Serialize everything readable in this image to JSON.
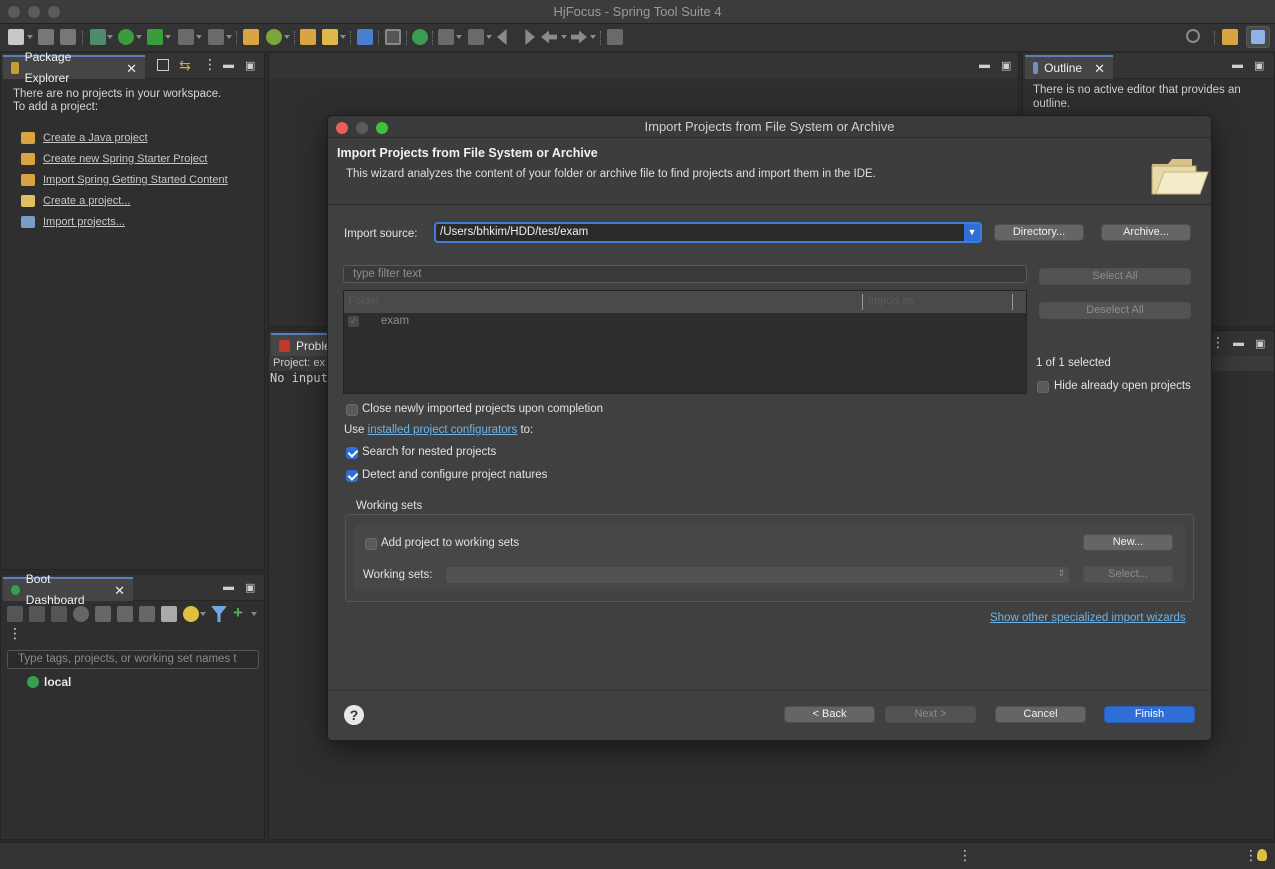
{
  "window": {
    "title": "HjFocus - Spring Tool Suite 4"
  },
  "package_explorer": {
    "tab_label": "Package Explorer",
    "empty_line1": "There are no projects in your workspace.",
    "empty_line2": "To add a project:",
    "links": [
      {
        "label": "Create a Java project",
        "icon": "java-project-icon"
      },
      {
        "label": "Create new Spring Starter Project",
        "icon": "spring-starter-icon"
      },
      {
        "label": "Import Spring Getting Started Content",
        "icon": "spring-guide-icon"
      },
      {
        "label": "Create a project...",
        "icon": "new-project-icon"
      },
      {
        "label": "Import projects...",
        "icon": "import-icon"
      }
    ]
  },
  "outline": {
    "tab_label": "Outline",
    "message": "There is no active editor that provides an outline."
  },
  "problems": {
    "tab_label": "Proble",
    "project_line": "Project: ex",
    "console_text": "No input"
  },
  "boot_dashboard": {
    "tab_label": "Boot Dashboard",
    "filter_placeholder": "Type tags, projects, or working set names t",
    "items": [
      {
        "label": "local"
      }
    ]
  },
  "dialog": {
    "title": "Import Projects from File System or Archive",
    "heading": "Import Projects from File System or Archive",
    "description": "This wizard analyzes the content of your folder or archive file to find projects and import them in the IDE.",
    "import_source_label": "Import source:",
    "import_source_value": "/Users/bhkim/HDD/test/exam",
    "directory_button": "Directory...",
    "archive_button": "Archive...",
    "filter_placeholder": "type filter text",
    "select_all_button": "Select All",
    "deselect_all_button": "Deselect All",
    "table": {
      "columns": [
        "Folder",
        "Import as"
      ],
      "rows": [
        {
          "folder": "exam",
          "checked": true
        }
      ]
    },
    "selected_count": "1 of 1 selected",
    "hide_open_label": "Hide already open projects",
    "close_imported_label": "Close newly imported projects upon completion",
    "use_prefix": "Use",
    "configurators_link": "installed project configurators",
    "use_suffix": "to:",
    "search_nested_label": "Search for nested projects",
    "detect_natures_label": "Detect and configure project natures",
    "working_sets_group": "Working sets",
    "add_to_working_sets_label": "Add project to working sets",
    "new_button": "New...",
    "working_sets_label": "Working sets:",
    "select_button": "Select...",
    "other_wizards_link": "Show other specialized import wizards",
    "back_button": "< Back",
    "next_button": "Next >",
    "cancel_button": "Cancel",
    "finish_button": "Finish"
  },
  "colors": {
    "accent": "#2f6ed6",
    "link": "#6fb3e6",
    "spring_green": "#6db33f"
  }
}
